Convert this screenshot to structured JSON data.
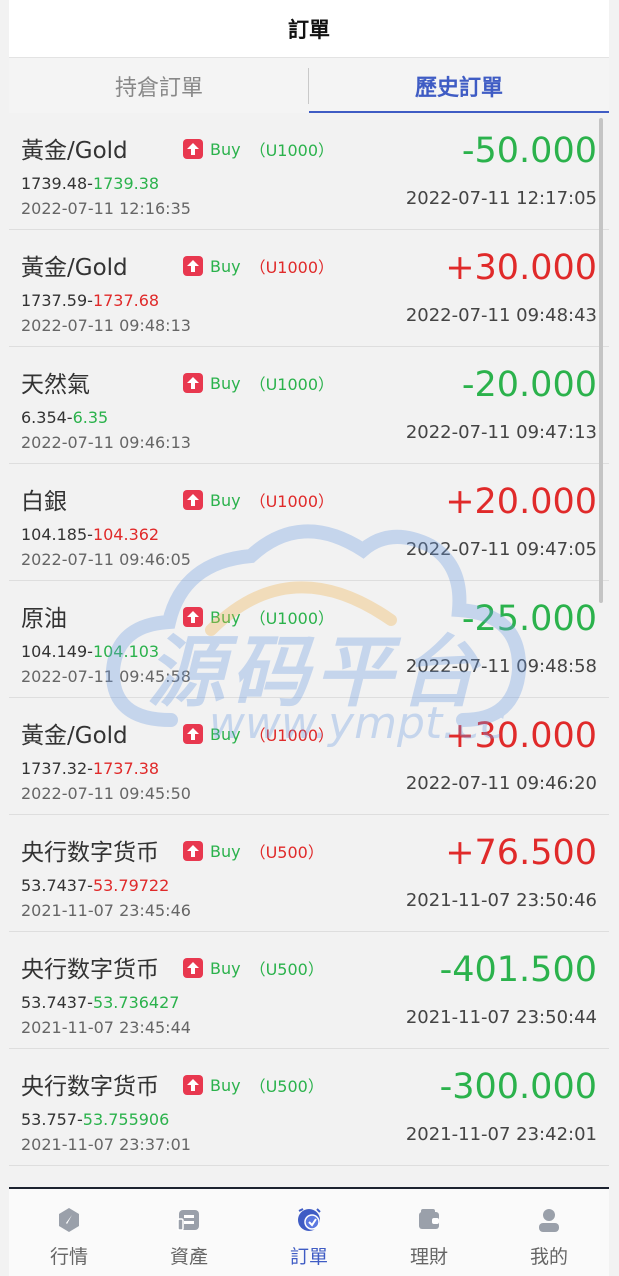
{
  "header": {
    "title": "訂單"
  },
  "tabs": [
    {
      "label": "持倉訂單",
      "active": false
    },
    {
      "label": "歷史訂單",
      "active": true
    }
  ],
  "colors": {
    "accent": "#3f5cc4",
    "profit": "#e02a2a",
    "loss": "#2bb24c",
    "buy_badge": "#e8384f"
  },
  "orders": [
    {
      "name": "黃金/Gold",
      "direction": "Buy",
      "lot": "（U1000）",
      "lot_color": "green",
      "open_price": "1739.48-",
      "close_price": "1739.38",
      "close_price_color": "green",
      "open_time": "2022-07-11 12:16:35",
      "pnl": "-50.000",
      "pnl_color": "green",
      "close_time": "2022-07-11 12:17:05"
    },
    {
      "name": "黃金/Gold",
      "direction": "Buy",
      "lot": "（U1000）",
      "lot_color": "red",
      "open_price": "1737.59-",
      "close_price": "1737.68",
      "close_price_color": "red",
      "open_time": "2022-07-11 09:48:13",
      "pnl": "+30.000",
      "pnl_color": "red",
      "close_time": "2022-07-11 09:48:43"
    },
    {
      "name": "天然氣",
      "direction": "Buy",
      "lot": "（U1000）",
      "lot_color": "green",
      "open_price": "6.354-",
      "close_price": "6.35",
      "close_price_color": "green",
      "open_time": "2022-07-11 09:46:13",
      "pnl": "-20.000",
      "pnl_color": "green",
      "close_time": "2022-07-11 09:47:13"
    },
    {
      "name": "白銀",
      "direction": "Buy",
      "lot": "（U1000）",
      "lot_color": "red",
      "open_price": "104.185-",
      "close_price": "104.362",
      "close_price_color": "red",
      "open_time": "2022-07-11 09:46:05",
      "pnl": "+20.000",
      "pnl_color": "red",
      "close_time": "2022-07-11 09:47:05"
    },
    {
      "name": "原油",
      "direction": "Buy",
      "lot": "（U1000）",
      "lot_color": "green",
      "open_price": "104.149-",
      "close_price": "104.103",
      "close_price_color": "green",
      "open_time": "2022-07-11 09:45:58",
      "pnl": "-25.000",
      "pnl_color": "green",
      "close_time": "2022-07-11 09:48:58"
    },
    {
      "name": "黃金/Gold",
      "direction": "Buy",
      "lot": "（U1000）",
      "lot_color": "red",
      "open_price": "1737.32-",
      "close_price": "1737.38",
      "close_price_color": "red",
      "open_time": "2022-07-11 09:45:50",
      "pnl": "+30.000",
      "pnl_color": "red",
      "close_time": "2022-07-11 09:46:20"
    },
    {
      "name": "央行数字货币",
      "direction": "Buy",
      "lot": "（U500）",
      "lot_color": "red",
      "open_price": "53.7437-",
      "close_price": "53.79722",
      "close_price_color": "red",
      "open_time": "2021-11-07 23:45:46",
      "pnl": "+76.500",
      "pnl_color": "red",
      "close_time": "2021-11-07 23:50:46"
    },
    {
      "name": "央行数字货币",
      "direction": "Buy",
      "lot": "（U500）",
      "lot_color": "green",
      "open_price": "53.7437-",
      "close_price": "53.736427",
      "close_price_color": "green",
      "open_time": "2021-11-07 23:45:44",
      "pnl": "-401.500",
      "pnl_color": "green",
      "close_time": "2021-11-07 23:50:44"
    },
    {
      "name": "央行数字货币",
      "direction": "Buy",
      "lot": "（U500）",
      "lot_color": "green",
      "open_price": "53.757-",
      "close_price": "53.755906",
      "close_price_color": "green",
      "open_time": "2021-11-07 23:37:01",
      "pnl": "-300.000",
      "pnl_color": "green",
      "close_time": "2021-11-07 23:42:01"
    }
  ],
  "watermark": {
    "text": "源码平台",
    "url": "www.ympt.cc"
  },
  "tabbar": [
    {
      "label": "行情",
      "icon": "compass-icon",
      "active": false
    },
    {
      "label": "資產",
      "icon": "wallet-card-icon",
      "active": false
    },
    {
      "label": "訂單",
      "icon": "orders-icon",
      "active": true
    },
    {
      "label": "理財",
      "icon": "purse-icon",
      "active": false
    },
    {
      "label": "我的",
      "icon": "user-icon",
      "active": false
    }
  ]
}
